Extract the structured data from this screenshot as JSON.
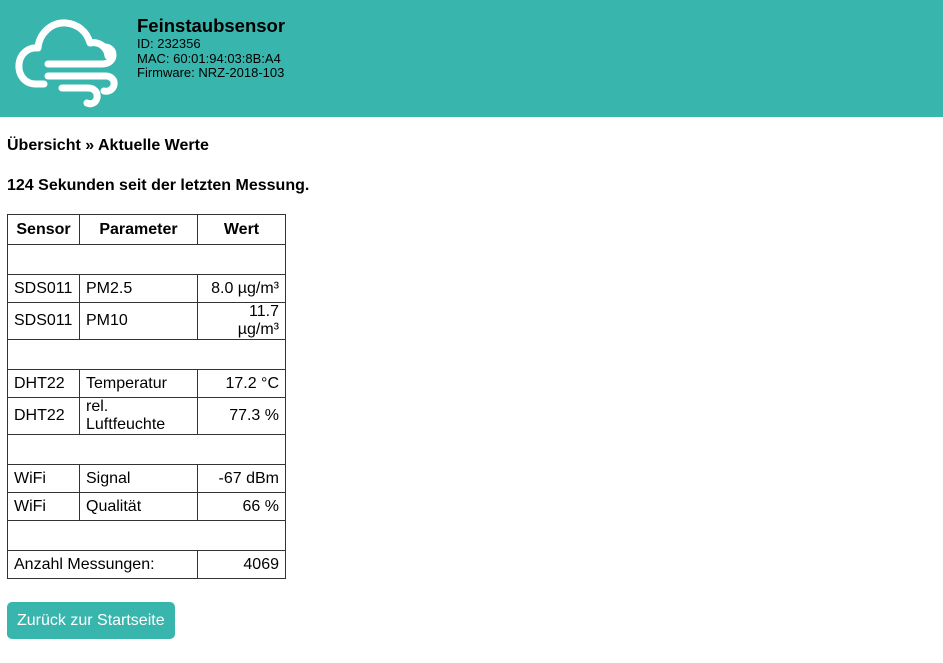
{
  "header": {
    "title": "Feinstaubsensor",
    "id_line": "ID: 232356",
    "mac_line": "MAC: 60:01:94:03:8B:A4",
    "firmware_line": "Firmware: NRZ-2018-103",
    "logo_icon": "cloud-wind-icon",
    "background_color": "#38b5ad"
  },
  "breadcrumb": "Übersicht » Aktuelle Werte",
  "status": "124 Sekunden seit der letzten Messung.",
  "table": {
    "headers": [
      "Sensor",
      "Parameter",
      "Wert"
    ],
    "rows": [
      {
        "sensor": "SDS011",
        "parameter": "PM2.5",
        "value": "8.0 µg/m³"
      },
      {
        "sensor": "SDS011",
        "parameter": "PM10",
        "value": "11.7 µg/m³"
      },
      {
        "sensor": "DHT22",
        "parameter": "Temperatur",
        "value": "17.2 °C"
      },
      {
        "sensor": "DHT22",
        "parameter": "rel. Luftfeuchte",
        "value": "77.3 %"
      },
      {
        "sensor": "WiFi",
        "parameter": "Signal",
        "value": "-67 dBm"
      },
      {
        "sensor": "WiFi",
        "parameter": "Qualität",
        "value": "66 %"
      }
    ],
    "count_label": "Anzahl Messungen:",
    "count_value": "4069"
  },
  "back_button": "Zurück zur Startseite"
}
